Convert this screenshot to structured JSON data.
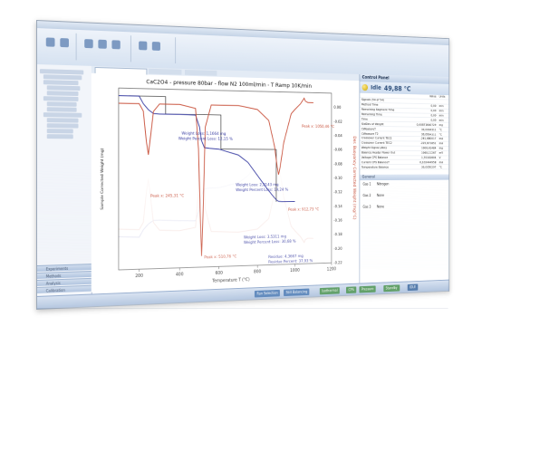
{
  "chart": {
    "title": "CaC2O4 - pressure 80bar - flow N2 100ml/min - T Ramp 10K/min",
    "xlabel": "Temperature T (°C)",
    "ylabel_left": "Sample Corrected Weight (mg)",
    "ylabel_right": "Der. Buoyancy Corrected Weight (mg/°C)",
    "xticks": [
      "200",
      "400",
      "600",
      "800",
      "1000",
      "1200"
    ],
    "yticks_right": [
      "0.00",
      "-0.02",
      "-0.04",
      "-0.06",
      "-0.08",
      "-0.10",
      "-0.12",
      "-0.14",
      "-0.16",
      "-0.18",
      "-0.20",
      "-0.22"
    ],
    "annotations": {
      "wl1": "Weight Loss: 1,1664 mg",
      "wpl1": "Weight Percent Loss: 12,15 %",
      "wl2": "Weight Loss: 2,2143 mg",
      "wpl2": "Weight Percent Loss: 19,24 %",
      "wl3": "Weight Loss: 3,5311 mg",
      "wpl3": "Weight Percent Loss: 30,68 %",
      "res": "Residue: 4,3667 mg",
      "rpc": "Residue Percent: 37,93 %",
      "peak1": "Peak x: 245,31 °C",
      "peak2": "Peak x: 510,76 °C",
      "peak3": "Peak x: 912,73 °C",
      "peak4": "Peak x: 1050,46 °C"
    }
  },
  "chart_data": {
    "type": "line",
    "title": "CaC2O4 - pressure 80bar - flow N2 100ml/min - T Ramp 10K/min",
    "xlabel": "Temperature T (°C)",
    "ylabel": "Sample Corrected Weight (mg)",
    "y2label": "Der. Buoyancy Corrected Weight (mg/°C)",
    "xlim": [
      100,
      1200
    ],
    "ylim": [
      0,
      12
    ],
    "y2lim": [
      -0.22,
      0.02
    ],
    "series": [
      {
        "axis": "left",
        "color": "#3a3fa3",
        "x": [
          100,
          200,
          220,
          245,
          270,
          300,
          400,
          480,
          500,
          510,
          525,
          550,
          600,
          700,
          750,
          800,
          850,
          880,
          900,
          912,
          930,
          950,
          1000
        ],
        "y": [
          11.5,
          11.5,
          11.0,
          10.6,
          10.35,
          10.33,
          10.33,
          10.3,
          9.5,
          8.6,
          8.1,
          8.05,
          8.0,
          7.6,
          7.1,
          6.2,
          5.3,
          4.8,
          4.5,
          4.4,
          4.37,
          4.37,
          4.37
        ]
      },
      {
        "axis": "right",
        "color": "#c8503a",
        "x": [
          100,
          200,
          220,
          235,
          245,
          255,
          270,
          300,
          400,
          480,
          495,
          505,
          511,
          518,
          530,
          560,
          620,
          700,
          800,
          860,
          890,
          905,
          912,
          920,
          940,
          980,
          1000,
          1030,
          1045,
          1050,
          1056,
          1070,
          1100
        ],
        "y": [
          0.0,
          0.0,
          -0.01,
          -0.05,
          -0.068,
          -0.045,
          -0.01,
          0.0,
          0.0,
          -0.005,
          -0.06,
          -0.16,
          -0.205,
          -0.15,
          -0.03,
          0.0,
          0.0,
          0.0,
          -0.005,
          -0.02,
          -0.055,
          -0.085,
          -0.095,
          -0.085,
          -0.05,
          -0.01,
          -0.004,
          0.004,
          0.01,
          0.012,
          0.008,
          0.006,
          0.006
        ]
      }
    ],
    "steps": [
      {
        "label": "Weight Loss: 1,1664 mg / Weight Percent Loss: 12,15 %",
        "x_from": 150,
        "x_to": 330,
        "y_from": 11.5,
        "y_to": 10.33
      },
      {
        "label": "Weight Loss: 2,2143 mg / Weight Percent Loss: 19,24 %",
        "x_from": 330,
        "x_to": 610,
        "y_from": 10.33,
        "y_to": 8.0
      },
      {
        "label": "Weight Loss: 3,5311 mg / Weight Percent Loss: 30,68 %",
        "x_from": 610,
        "x_to": 900,
        "y_from": 8.0,
        "y_to": 4.37
      }
    ]
  },
  "control_panel": {
    "title": "Control Panel",
    "state": "Idle",
    "temperature": "49,88 °C",
    "col_value": "Value",
    "col_units": "Units",
    "rows": [
      {
        "name": "Signals (54 of 54)",
        "value": "",
        "unit": ""
      },
      {
        "name": "Method Time",
        "value": "0,00",
        "unit": "min"
      },
      {
        "name": "Remaining Segment Time",
        "value": "0,00",
        "unit": "min"
      },
      {
        "name": "Remaining Time",
        "value": "0,00",
        "unit": "min"
      },
      {
        "name": "Time",
        "value": "0,00",
        "unit": "min"
      },
      {
        "name": "StdDev of Weight",
        "value": "0,00871640729",
        "unit": "mg"
      },
      {
        "name": "CWeasureT",
        "value": "30,0004311",
        "unit": "°C"
      },
      {
        "name": "CWeasure T2",
        "value": "30,0004311",
        "unit": "°C"
      },
      {
        "name": "Crossover Current TEC1",
        "value": "-261,680017",
        "unit": "mA"
      },
      {
        "name": "Crossover Current TEC2",
        "value": "-225,671651",
        "unit": "mA"
      },
      {
        "name": "Weight Signal (Abs)",
        "value": "1006,42484",
        "unit": "mg"
      },
      {
        "name": "Balance Heater Power Out",
        "value": "1068,11267",
        "unit": "mV"
      },
      {
        "name": "Voltage CPS Balance",
        "value": "1,70102604",
        "unit": "V"
      },
      {
        "name": "Current CPS BalanceT",
        "value": "0,102444958",
        "unit": "mA"
      },
      {
        "name": "Temperature Balance",
        "value": "30,0050297",
        "unit": "°C"
      }
    ]
  },
  "general": {
    "title": "General",
    "gases": [
      {
        "name": "Gas 1",
        "value": "Nitrogen"
      },
      {
        "name": "Gas 2",
        "value": "None"
      },
      {
        "name": "Gas 3",
        "value": "None"
      }
    ]
  },
  "left_nav": [
    "Experiments",
    "Methods",
    "Analysis",
    "Calibration"
  ],
  "status_bar": {
    "segments": [
      "Run Selection",
      "Still Balancing",
      "Isothermal",
      "CPS",
      "Pressure",
      "Standby",
      "IDLE"
    ]
  },
  "colors": {
    "weight_curve": "#3a3fa3",
    "derivative_curve": "#c8503a",
    "accent_blue": "#2d4e7a"
  }
}
